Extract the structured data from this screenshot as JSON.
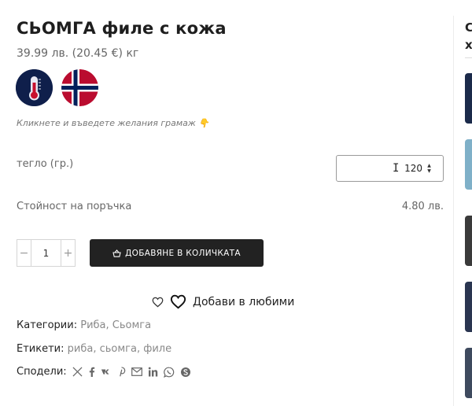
{
  "product": {
    "title": "СЬОМГА филе с кожа",
    "price": "39.99 лв. (20.45 €) кг",
    "badges": [
      "thermometer-icon",
      "norway-flag-icon"
    ],
    "hint": "Кликнете и въведете желания грамаж 👇"
  },
  "weight": {
    "label": "тегло (гр.)",
    "value": "120"
  },
  "total": {
    "label": "Стойност на поръчка",
    "value": "4.80 лв."
  },
  "quantity": {
    "minus": "−",
    "value": "1",
    "plus": "+"
  },
  "add_to_cart": {
    "label": "ДОБАВЯНЕ В КОЛИЧКАТА"
  },
  "favorites": {
    "label": "Добави в любими"
  },
  "meta": {
    "categories_label": "Категории:",
    "categories": "Риба, Сьомга",
    "tags_label": "Етикети:",
    "tags": "риба, сьомга, филе",
    "share_label": "Сподели:",
    "share_icons": [
      "x-icon",
      "facebook-icon",
      "vk-icon",
      "pinterest-icon",
      "email-icon",
      "linkedin-icon",
      "whatsapp-icon",
      "skype-icon"
    ]
  },
  "sidebar": {
    "title_line1": "С",
    "title_line2": "х"
  },
  "colors": {
    "button_bg": "#222222",
    "badge_navy": "#0f1f4b",
    "flag_red": "#ba0c2f",
    "flag_blue": "#00205b"
  }
}
